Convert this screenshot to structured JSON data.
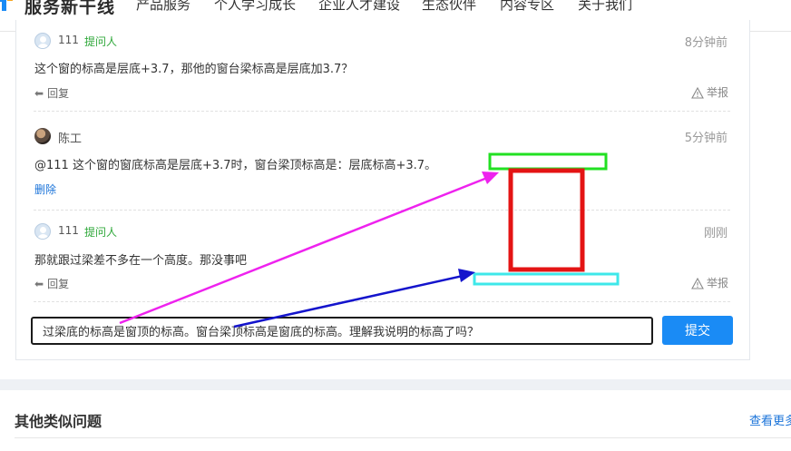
{
  "nav": {
    "logo_text": "服务新干线",
    "items": [
      "产品服务",
      "个人学习成长",
      "企业人才建设",
      "生态伙伴",
      "内容专区",
      "关于我们"
    ]
  },
  "comments": [
    {
      "user": "111",
      "role": "提问人",
      "time": "8分钟前",
      "content": "这个窗的标高是层底+3.7，那他的窗台梁标高是层底加3.7？",
      "reply_label": "回复",
      "report_label": "举报"
    },
    {
      "user": "陈工",
      "time": "5分钟前",
      "content": "@111  这个窗的窗底标高是层底+3.7时，窗台梁顶标高是：层底标高+3.7。",
      "delete_label": "删除"
    },
    {
      "user": "111",
      "role": "提问人",
      "time": "刚刚",
      "content": "那就跟过梁差不多在一个高度。那没事吧",
      "reply_label": "回复",
      "report_label": "举报"
    }
  ],
  "reply_box": {
    "value": "过梁底的标高是窗顶的标高。窗台梁顶标高是窗底的标高。理解我说明的标高了吗？",
    "submit_label": "提交"
  },
  "similar": {
    "title": "其他类似问题",
    "view_more": "查看更多"
  },
  "colors": {
    "accent": "#1a8bf5",
    "role_green": "#2fa83a",
    "annotation_green": "#22e022",
    "annotation_red": "#e41414",
    "annotation_cyan": "#3ee8ea",
    "annotation_magenta": "#ee22ee",
    "annotation_blue": "#1414cc"
  }
}
